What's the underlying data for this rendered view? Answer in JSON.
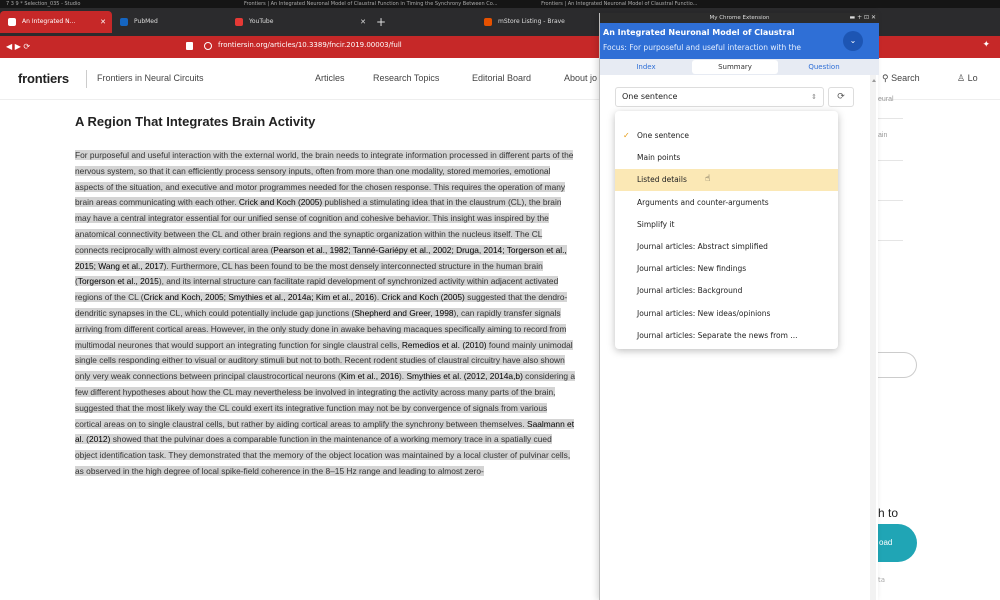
{
  "os_bar": {
    "left_text": "7 3 9 * Selection_035 - Studio",
    "middle_text": "Frontiers | An Integrated Neuronal Model of Claustral Function in Timing the Synchrony Between Co...",
    "right_text": "Frontiers | An Integrated Neuronal Model of Claustral Functio..."
  },
  "tabs": [
    {
      "label": "An Integrated N...",
      "color": "#e53935",
      "active": true
    },
    {
      "label": "PubMed",
      "color": "#1565c0",
      "active": false
    },
    {
      "label": "YouTube",
      "color": "#e53935",
      "active": false
    },
    {
      "label": "My Chrome Extension",
      "color": "#555555",
      "active": false
    },
    {
      "label": "mStore Listing - Brave",
      "color": "#e65100",
      "active": false
    }
  ],
  "address": {
    "url": "frontiersin.org/articles/10.3389/fncir.2019.00003/full"
  },
  "site": {
    "logo": "frontiers",
    "journal": "Frontiers in Neural Circuits",
    "nav": [
      "Articles",
      "Research Topics",
      "Editorial Board",
      "About jo"
    ],
    "search": "Search",
    "login": "Lo"
  },
  "article": {
    "title": "A Region That Integrates Brain Activity",
    "body_html": "<span class=\"hl\">For purposeful and useful interaction with the external world, the brain needs to integrate information processed in different parts of the nervous system, so that it can efficiently process sensory inputs, often from more than one modality, stored memories, emotional aspects of the situation, and executive and motor programmes needed for the chosen response. This requires the operation of many brain areas communicating with each other. <b>Crick and Koch (2005)</b> published a stimulating idea that in the claustrum (CL), the brain may have a central integrator essential for our unified sense of cognition and cohesive behavior. This insight was inspired by the anatomical connectivity between the CL and other brain regions and the synaptic organization within the nucleus itself. The CL connects reciprocally with almost every cortical area (<b>Pearson et al., 1982; Tanné-Gariépy et al., 2002; Druga, 2014; Torgerson et al., 2015; Wang et al., 2017</b>). Furthermore, CL has been found to be the most densely interconnected structure in the human brain (<b>Torgerson et al., 2015</b>), and its internal structure can facilitate rapid development of synchronized activity within adjacent activated regions of the CL (<b>Crick and Koch, 2005; Smythies et al., 2014a; Kim et al., 2016</b>). <b>Crick and Koch (2005)</b> suggested that the dendro-dendritic synapses in the CL, which could potentially include gap junctions (<b>Shepherd and Greer, 1998</b>), can rapidly transfer signals arriving from different cortical areas. However, in the only study done in awake behaving macaques specifically aiming to record from multimodal neurones that would support an integrating function for single claustral cells, <b>Remedios et al. (2010)</b> found mainly unimodal single cells responding either to visual or auditory stimuli but not to both. Recent rodent studies of claustral circuitry have also shown only very weak connections between principal claustrocortical neurons (<b>Kim et al., 2016</b>). <b>Smythies et al. (2012, 2014a,b)</b> considering a few different hypotheses about how the CL may nevertheless be involved in integrating the activity across many parts of the brain, suggested that the most likely way the CL could exert its integrative function may not be by convergence of signals from various cortical areas on to single claustral cells, but rather by aiding cortical areas to amplify the synchrony between themselves. <b>Saalmann et al. (2012)</b> showed that the pulvinar does a comparable function in the maintenance of a working memory trace in a spatially cued object identification task. They demonstrated that the memory of the object location was maintained by a local cluster of pulvinar cells, as observed in the high degree of local spike-field coherence in the 8–15 Hz range and leading to almost zero-</span>"
  },
  "right_column": {
    "fragments": [
      "eural",
      "ain",
      "h to"
    ],
    "download_label": "oad",
    "small_text": "ta"
  },
  "extension": {
    "window_title": "My Chrome Extension",
    "title": "An Integrated Neuronal Model of Claustral",
    "focus": "Focus: For purposeful and useful interaction with the",
    "tabs": [
      "Index",
      "Summary",
      "Question"
    ],
    "active_tab": 1,
    "selected_mode": "One sentence",
    "refresh_icon": "refresh-icon",
    "options": [
      "One sentence",
      "Main points",
      "Listed details",
      "Arguments and counter-arguments",
      "Simplify it",
      "Journal articles: Abstract simplified",
      "Journal articles: New findings",
      "Journal articles: Background",
      "Journal articles: New ideas/opinions",
      "Journal articles: Separate the news from ..."
    ],
    "checked_index": 0,
    "hover_index": 2
  }
}
